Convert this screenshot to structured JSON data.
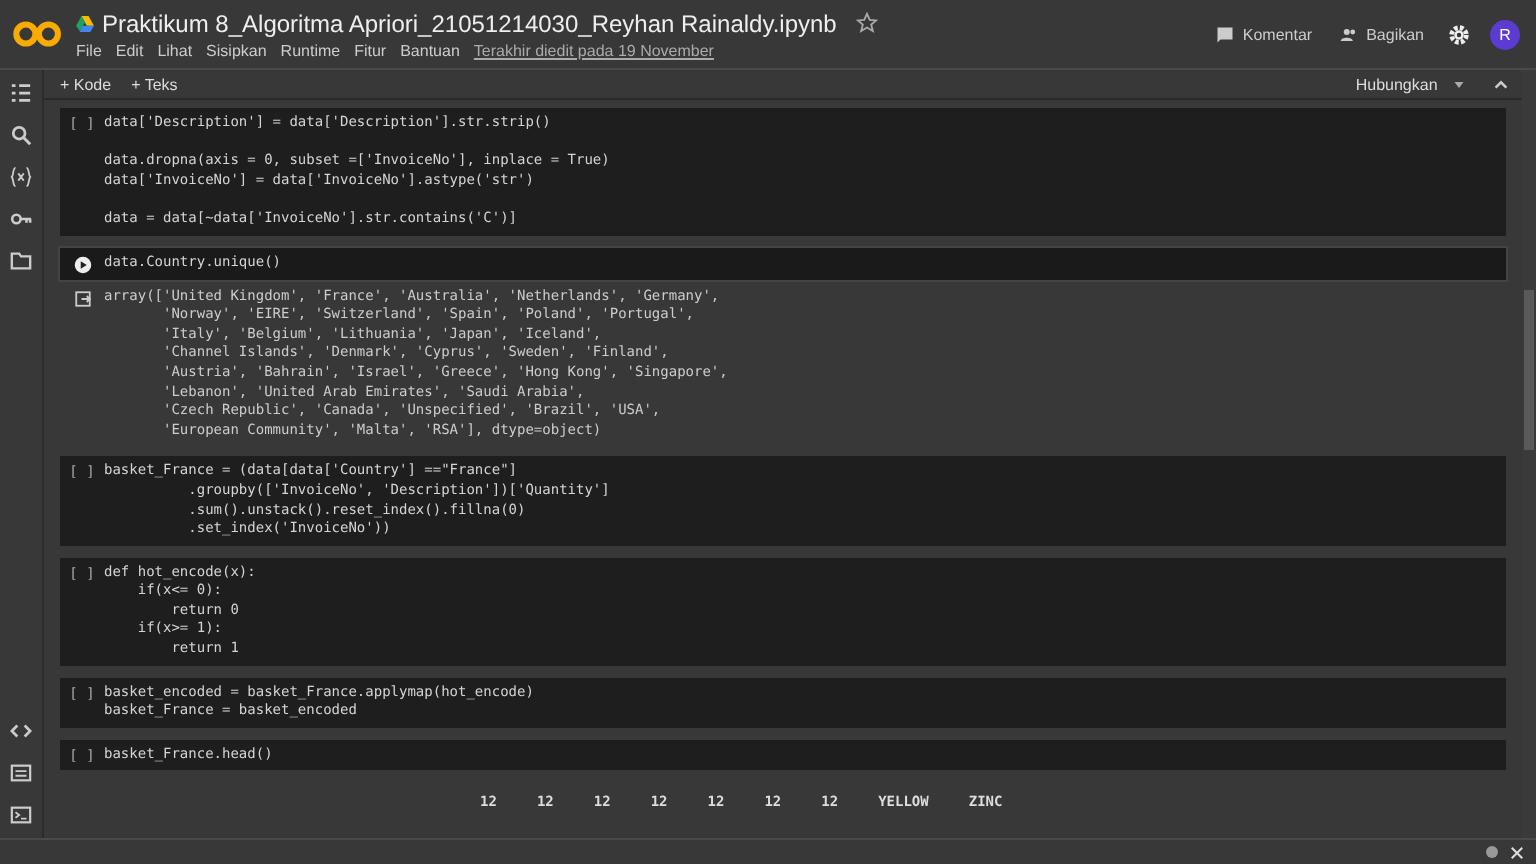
{
  "header": {
    "title": "Praktikum 8_Algoritma Apriori_21051214030_Reyhan Rainaldy.ipynb",
    "menu": [
      "File",
      "Edit",
      "Lihat",
      "Sisipkan",
      "Runtime",
      "Fitur",
      "Bantuan"
    ],
    "last_edited": "Terakhir diedit pada 19 November",
    "actions": [
      "Komentar",
      "Bagikan"
    ],
    "avatar": "R"
  },
  "toolbar": {
    "add": [
      "+ Kode",
      "+ Teks"
    ],
    "connect": "Hubungkan"
  },
  "cells": [
    {
      "focused": false,
      "prompt": "[ ]",
      "lines": [
        "data['Description'] = data['Description'].str.strip()"
      ],
      "more_blocks": [
        [
          "data.dropna(axis = 0, subset =['InvoiceNo'], inplace = True)",
          "data['InvoiceNo'] = data['InvoiceNo'].astype('str')"
        ],
        [
          "data = data[~data['InvoiceNo'].str.contains('C')]"
        ]
      ]
    },
    {
      "focused": true,
      "lines": [
        "data.Country.unique()"
      ],
      "output": [
        "array(['United Kingdom', 'France', 'Australia', 'Netherlands', 'Germany',",
        "       'Norway', 'EIRE', 'Switzerland', 'Spain', 'Poland', 'Portugal',",
        "       'Italy', 'Belgium', 'Lithuania', 'Japan', 'Iceland',",
        "       'Channel Islands', 'Denmark', 'Cyprus', 'Sweden', 'Finland',",
        "       'Austria', 'Bahrain', 'Israel', 'Greece', 'Hong Kong', 'Singapore',",
        "       'Lebanon', 'United Arab Emirates', 'Saudi Arabia',",
        "       'Czech Republic', 'Canada', 'Unspecified', 'Brazil', 'USA',",
        "       'European Community', 'Malta', 'RSA'], dtype=object)"
      ]
    },
    {
      "focused": false,
      "prompt": "[ ]",
      "lines": [
        "basket_France = (data[data['Country'] ==\"France\"]",
        "          .groupby(['InvoiceNo', 'Description'])['Quantity']",
        "          .sum().unstack().reset_index().fillna(0)",
        "          .set_index('InvoiceNo'))"
      ]
    },
    {
      "focused": false,
      "prompt": "[ ]",
      "lines": [
        "def hot_encode(x):",
        "    if(x<= 0):",
        "        return 0",
        "    if(x>= 1):",
        "        return 1"
      ]
    },
    {
      "focused": false,
      "prompt": "[ ]",
      "lines": [
        "basket_encoded = basket_France.applymap(hot_encode)",
        "basket_France = basket_encoded"
      ]
    },
    {
      "focused": false,
      "prompt": "[ ]",
      "lines": [
        "basket_France.head()"
      ],
      "table_header": [
        "12",
        "12",
        "12",
        "12",
        "12",
        "12",
        "12",
        "YELLOW",
        "ZINC"
      ]
    }
  ]
}
